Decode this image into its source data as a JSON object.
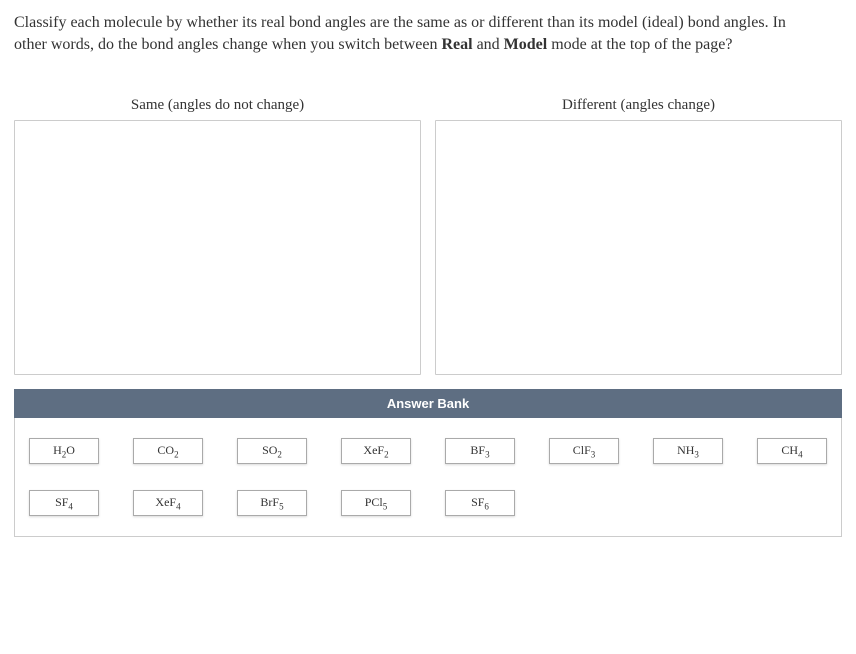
{
  "question": {
    "line1": "Classify each molecule by whether its real bond angles are the same as or different than its model (ideal) bond angles. In",
    "line2_prefix": "other words, do the bond angles change when you switch between ",
    "bold1": "Real",
    "mid": " and ",
    "bold2": "Model",
    "line2_suffix": " mode at the top of the page?"
  },
  "dropzones": {
    "left_label": "Same (angles do not change)",
    "right_label": "Different (angles change)"
  },
  "answer_bank": {
    "header": "Answer Bank",
    "molecules": [
      {
        "base": "H",
        "sub": "2",
        "tail": "O"
      },
      {
        "base": "CO",
        "sub": "2",
        "tail": ""
      },
      {
        "base": "SO",
        "sub": "2",
        "tail": ""
      },
      {
        "base": "XeF",
        "sub": "2",
        "tail": ""
      },
      {
        "base": "BF",
        "sub": "3",
        "tail": ""
      },
      {
        "base": "ClF",
        "sub": "3",
        "tail": ""
      },
      {
        "base": "NH",
        "sub": "3",
        "tail": ""
      },
      {
        "base": "CH",
        "sub": "4",
        "tail": ""
      },
      {
        "base": "SF",
        "sub": "4",
        "tail": ""
      },
      {
        "base": "XeF",
        "sub": "4",
        "tail": ""
      },
      {
        "base": "BrF",
        "sub": "5",
        "tail": ""
      },
      {
        "base": "PCl",
        "sub": "5",
        "tail": ""
      },
      {
        "base": "SF",
        "sub": "6",
        "tail": ""
      }
    ]
  }
}
